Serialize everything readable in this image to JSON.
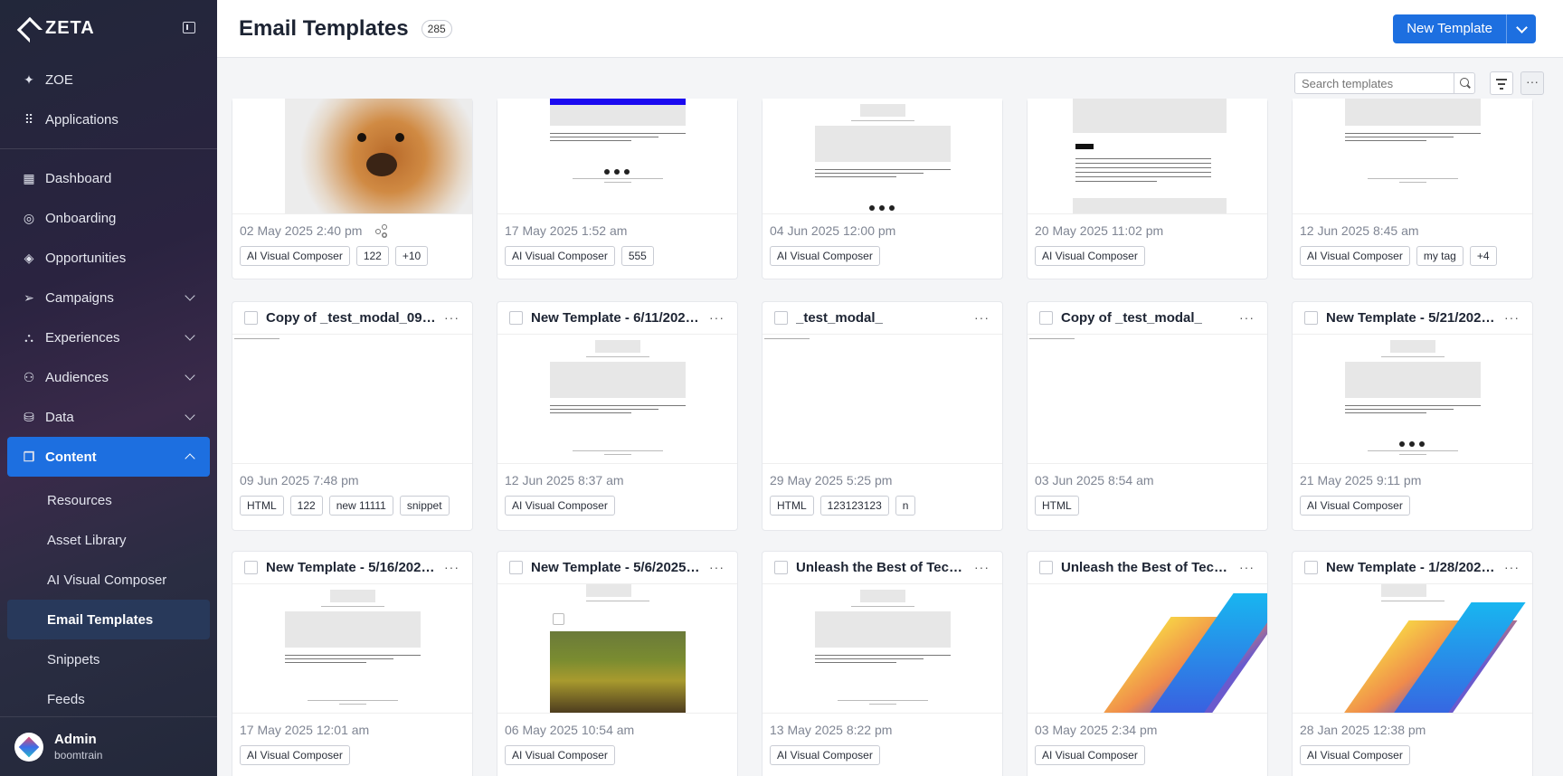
{
  "brand": "ZETA",
  "sidebar": {
    "top": [
      {
        "label": "ZOE",
        "icon": "sparkle-icon"
      },
      {
        "label": "Applications",
        "icon": "grid-icon"
      }
    ],
    "main": [
      {
        "label": "Dashboard",
        "icon": "dashboard-icon",
        "chevron": false
      },
      {
        "label": "Onboarding",
        "icon": "compass-icon",
        "chevron": false
      },
      {
        "label": "Opportunities",
        "icon": "target-icon",
        "chevron": false
      },
      {
        "label": "Campaigns",
        "icon": "send-icon",
        "chevron": true
      },
      {
        "label": "Experiences",
        "icon": "flow-icon",
        "chevron": true
      },
      {
        "label": "Audiences",
        "icon": "audience-icon",
        "chevron": true
      },
      {
        "label": "Data",
        "icon": "database-icon",
        "chevron": true
      },
      {
        "label": "Content",
        "icon": "content-icon",
        "chevron": true
      }
    ],
    "content_sub": [
      "Resources",
      "Asset Library",
      "AI Visual Composer",
      "Email Templates",
      "Snippets",
      "Feeds"
    ],
    "user": {
      "name": "Admin",
      "org": "boomtrain"
    }
  },
  "header": {
    "title": "Email Templates",
    "count": "285",
    "new_button": "New Template"
  },
  "toolbar": {
    "search_placeholder": "Search templates",
    "more": "···"
  },
  "accent": "#1d6fe0",
  "rows": [
    [
      {
        "date": "02 May 2025 2:40 pm",
        "tags": [
          "AI Visual Composer",
          "122",
          "+10"
        ],
        "share": true,
        "thumb": "dog"
      },
      {
        "date": "17 May 2025 1:52 am",
        "tags": [
          "AI Visual Composer",
          "555"
        ],
        "thumb": "email-blue"
      },
      {
        "date": "04 Jun 2025 12:00 pm",
        "tags": [
          "AI Visual Composer"
        ],
        "thumb": "email"
      },
      {
        "date": "20 May 2025 11:02 pm",
        "tags": [
          "AI Visual Composer"
        ],
        "thumb": "test"
      },
      {
        "date": "12 Jun 2025 8:45 am",
        "tags": [
          "AI Visual Composer",
          "my tag",
          "+4"
        ],
        "thumb": "email-short"
      }
    ],
    [
      {
        "name": "Copy of _test_modal_09062...",
        "date": "09 Jun 2025 7:48 pm",
        "tags": [
          "HTML",
          "122",
          "new 11111",
          "snippet"
        ],
        "thumb": "blank"
      },
      {
        "name": "New Template - 6/11/2025 ...",
        "date": "12 Jun 2025 8:37 am",
        "tags": [
          "AI Visual Composer"
        ],
        "thumb": "email-plain"
      },
      {
        "name": "_test_modal_",
        "date": "29 May 2025 5:25 pm",
        "tags": [
          "HTML",
          "123123123",
          "n"
        ],
        "thumb": "blank"
      },
      {
        "name": "Copy of _test_modal_",
        "date": "03 Jun 2025 8:54 am",
        "tags": [
          "HTML"
        ],
        "thumb": "blank"
      },
      {
        "name": "New Template - 5/21/2025 ...",
        "date": "21 May 2025 9:11 pm",
        "tags": [
          "AI Visual Composer"
        ],
        "thumb": "email"
      }
    ],
    [
      {
        "name": "New Template - 5/16/2025 ...",
        "date": "17 May 2025 12:01 am",
        "tags": [
          "AI Visual Composer"
        ],
        "thumb": "email-plain"
      },
      {
        "name": "New Template - 5/6/2025 1:...",
        "date": "06 May 2025 10:54 am",
        "tags": [
          "AI Visual Composer"
        ],
        "thumb": "landscape"
      },
      {
        "name": "Unleash the Best of Tech Thi...",
        "date": "13 May 2025 8:22 pm",
        "tags": [
          "AI Visual Composer"
        ],
        "thumb": "email-plain"
      },
      {
        "name": "Unleash the Best of Tech Thi...",
        "date": "03 May 2025 2:34 pm",
        "tags": [
          "AI Visual Composer"
        ],
        "thumb": "gradient"
      },
      {
        "name": "New Template - 1/28/2025 ...",
        "date": "28 Jan 2025 12:38 pm",
        "tags": [
          "AI Visual Composer"
        ],
        "thumb": "gradient-small"
      }
    ]
  ]
}
